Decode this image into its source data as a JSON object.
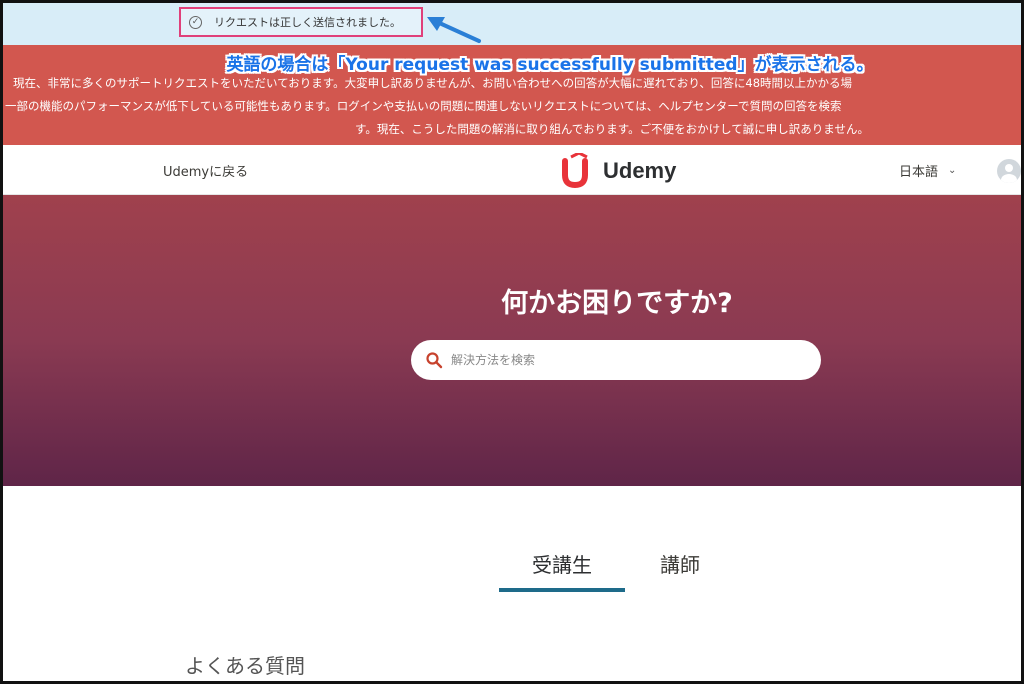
{
  "success": {
    "message": "リクエストは正しく送信されました。",
    "icon": "check-circle-icon"
  },
  "annotation": {
    "text": "英語の場合は「Your request was successfully submitted」が表示される。",
    "color": "#1a73e8"
  },
  "notice": {
    "line1": "現在、非常に多くのサポートリクエストをいただいております。大変申し訳ありませんが、お問い合わせへの回答が大幅に遅れており、回答に48時間以上かかる場",
    "line2": "一部の機能のパフォーマンスが低下している可能性もあります。ログインや支払いの問題に関連しないリクエストについては、ヘルプセンターで質問の回答を検索",
    "line3": "す。現在、こうした問題の解消に取り組んでおります。ご不便をおかけして誠に申し訳ありません。",
    "background": "#d2574f"
  },
  "header": {
    "back_label": "Udemyに戻る",
    "logo_text": "Udemy",
    "language": "日本語",
    "brand_color": "#a435f0"
  },
  "hero": {
    "title": "何かお困りですか?",
    "search_placeholder": "解決方法を検索"
  },
  "tabs": [
    {
      "label": "受講生",
      "active": true
    },
    {
      "label": "講師",
      "active": false
    }
  ],
  "faq": {
    "heading": "よくある質問"
  },
  "colors": {
    "tab_underline": "#1e6b8a",
    "success_highlight": "#e0407a"
  }
}
